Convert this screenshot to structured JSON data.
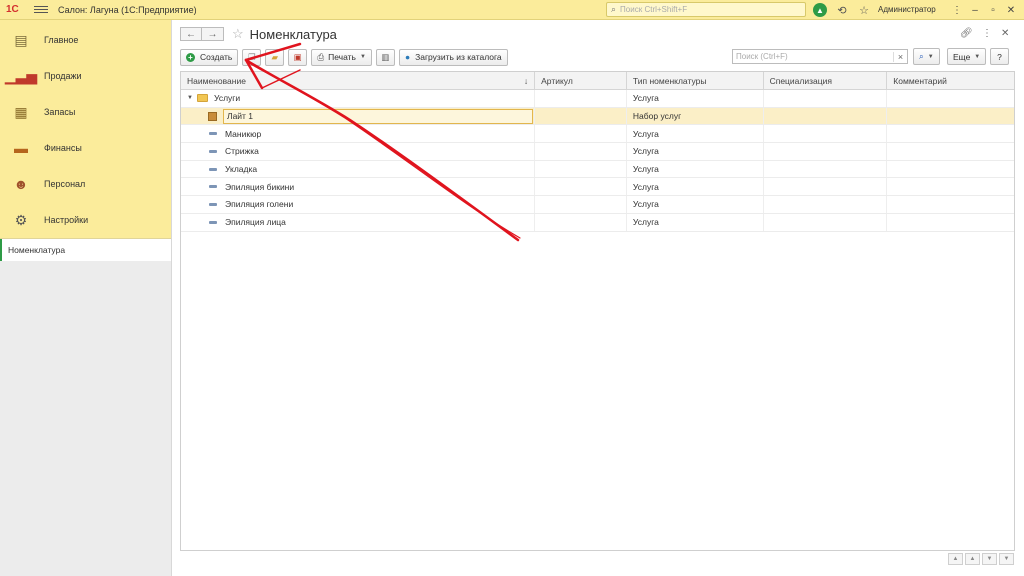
{
  "titlebar": {
    "logo": "1С",
    "title": "Салон: Лагуна  (1С:Предприятие)",
    "search_placeholder": "Поиск Ctrl+Shift+F",
    "user": "Администратор"
  },
  "sidebar": {
    "sections": [
      {
        "label": "Главное",
        "icon": "main-icon",
        "color": "#7a6a3a"
      },
      {
        "label": "Продажи",
        "icon": "sales-chart-icon",
        "color": "#c0392b"
      },
      {
        "label": "Запасы",
        "icon": "stock-icon",
        "color": "#8a6d2a"
      },
      {
        "label": "Финансы",
        "icon": "wallet-icon",
        "color": "#b5651d"
      },
      {
        "label": "Персонал",
        "icon": "people-icon",
        "color": "#a0522d"
      },
      {
        "label": "Настройки",
        "icon": "gear-icon",
        "color": "#555555"
      }
    ],
    "open_windows": [
      {
        "label": "Номенклатура"
      }
    ]
  },
  "form": {
    "title": "Номенклатура",
    "toolbar": {
      "create_label": "Создать",
      "print_label": "Печать",
      "load_label": "Загрузить из каталога",
      "search_placeholder": "Поиск (Ctrl+F)",
      "more_label": "Еще",
      "help_label": "?"
    },
    "columns": [
      "Наименование",
      "Артикул",
      "Тип номенклатуры",
      "Специализация",
      "Комментарий"
    ],
    "rows": [
      {
        "kind": "folder",
        "name": "Услуги",
        "article": "",
        "type": "Услуга",
        "spec": "",
        "comment": ""
      },
      {
        "kind": "set",
        "name": "Лайт 1",
        "article": "",
        "type": "Набор услуг",
        "spec": "",
        "comment": "",
        "selected": true
      },
      {
        "kind": "item",
        "name": "Маникюр",
        "article": "",
        "type": "Услуга",
        "spec": "",
        "comment": ""
      },
      {
        "kind": "item",
        "name": "Стрижка",
        "article": "",
        "type": "Услуга",
        "spec": "",
        "comment": ""
      },
      {
        "kind": "item",
        "name": "Укладка",
        "article": "",
        "type": "Услуга",
        "spec": "",
        "comment": ""
      },
      {
        "kind": "item",
        "name": "Эпиляция бикини",
        "article": "",
        "type": "Услуга",
        "spec": "",
        "comment": ""
      },
      {
        "kind": "item",
        "name": "Эпиляция голени",
        "article": "",
        "type": "Услуга",
        "spec": "",
        "comment": ""
      },
      {
        "kind": "item",
        "name": "Эпиляция лица",
        "article": "",
        "type": "Услуга",
        "spec": "",
        "comment": ""
      }
    ]
  },
  "colors": {
    "accent_yellow": "#fbec9b",
    "selection": "#fbefc7",
    "green": "#2e9b46",
    "annotation_red": "#e0141e"
  }
}
